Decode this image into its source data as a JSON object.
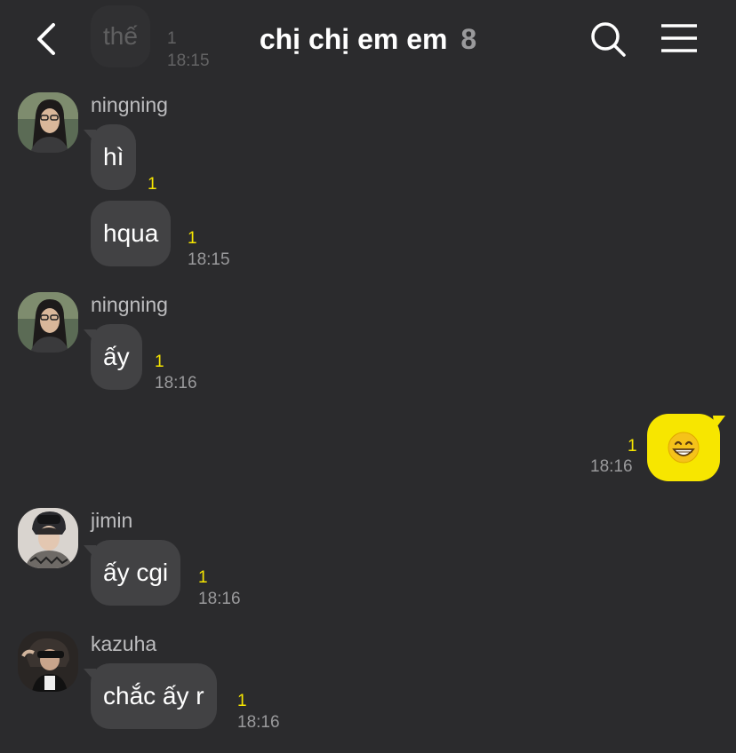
{
  "header": {
    "title": "chị chị em em",
    "member_count": "8",
    "back_icon": "chevron-left-icon",
    "search_icon": "search-icon",
    "menu_icon": "hamburger-menu-icon"
  },
  "clipped_message": {
    "text": "thế",
    "unread": "1",
    "time": "18:15"
  },
  "messages": [
    {
      "sender": "ningning",
      "text": "hì",
      "unread": "1",
      "time": ""
    },
    {
      "sender": "",
      "text": "hqua",
      "unread": "1",
      "time": "18:15"
    },
    {
      "sender": "ningning",
      "text": "ấy",
      "unread": "1",
      "time": "18:16"
    },
    {
      "sender": "me",
      "text": "😁",
      "unread": "1",
      "time": "18:16"
    },
    {
      "sender": "jimin",
      "text": "ấy cgi",
      "unread": "1",
      "time": "18:16"
    },
    {
      "sender": "kazuha",
      "text": "chắc ấy r",
      "unread": "1",
      "time": "18:16"
    }
  ],
  "colors": {
    "background": "#2b2b2d",
    "bubble_other": "#424244",
    "bubble_me": "#f7e600",
    "unread": "#f7e600",
    "time": "#9a9a9c",
    "sender": "#bdbdbf"
  }
}
